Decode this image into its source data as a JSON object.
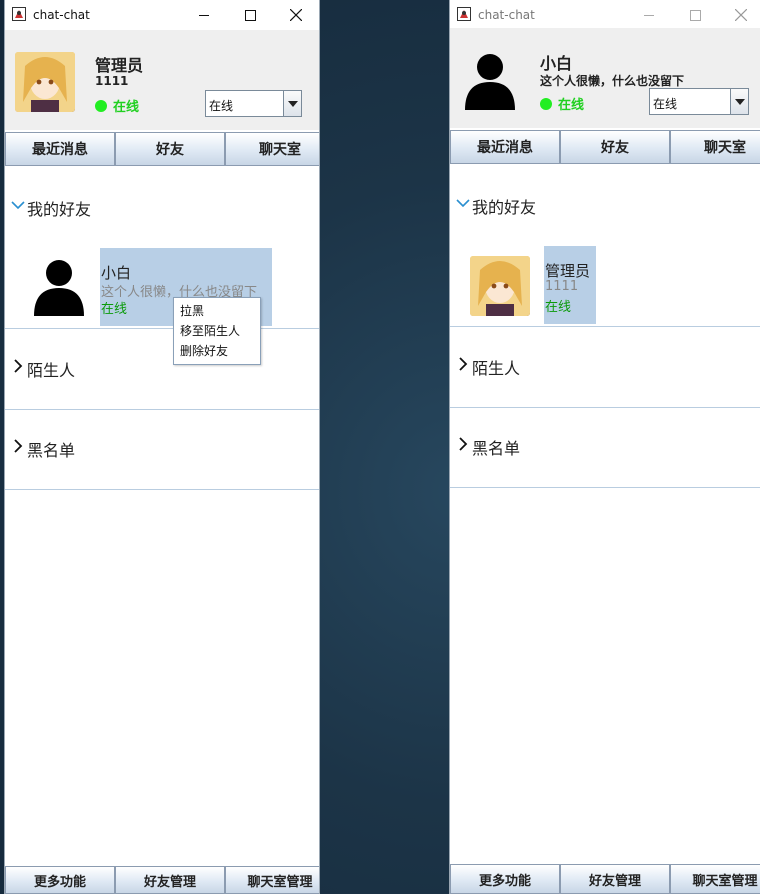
{
  "windows": [
    {
      "title": "chat-chat",
      "user": {
        "name": "管理员",
        "subline": "1111",
        "status": "在线"
      },
      "status_select": {
        "value": "在线"
      },
      "tabs": [
        "最近消息",
        "好友",
        "聊天室"
      ],
      "groups": [
        {
          "label": "我的好友",
          "expanded": true
        },
        {
          "label": "陌生人",
          "expanded": false
        },
        {
          "label": "黑名单",
          "expanded": false
        }
      ],
      "friend": {
        "name": "小白",
        "signature": "这个人很懒，什么也没留下",
        "status": "在线"
      },
      "context_menu": [
        "拉黑",
        "移至陌生人",
        "删除好友"
      ],
      "bottom_buttons": [
        "更多功能",
        "好友管理",
        "聊天室管理"
      ]
    },
    {
      "title": "chat-chat",
      "user": {
        "name": "小白",
        "subline": "这个人很懒，什么也没留下",
        "status": "在线"
      },
      "status_select": {
        "value": "在线"
      },
      "tabs": [
        "最近消息",
        "好友",
        "聊天室"
      ],
      "groups": [
        {
          "label": "我的好友",
          "expanded": true
        },
        {
          "label": "陌生人",
          "expanded": false
        },
        {
          "label": "黑名单",
          "expanded": false
        }
      ],
      "friend": {
        "name": "管理员",
        "signature": "1111",
        "status": "在线"
      },
      "bottom_buttons": [
        "更多功能",
        "好友管理",
        "聊天室管理"
      ]
    }
  ],
  "colors": {
    "status_green": "#22ee22",
    "selection": "#b8cfe6",
    "group_chevron": "#2a8fd0"
  }
}
